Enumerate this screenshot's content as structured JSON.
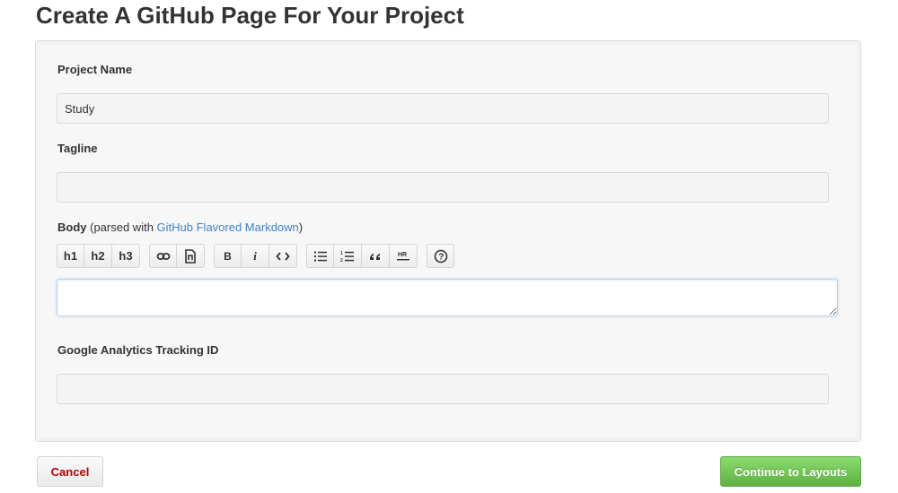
{
  "page": {
    "title": "Create A GitHub Page For Your Project"
  },
  "form": {
    "project_name": {
      "label": "Project Name",
      "value": "Study",
      "placeholder": ""
    },
    "tagline": {
      "label": "Tagline",
      "value": "",
      "placeholder": ""
    },
    "body": {
      "label": "Body",
      "note_prefix": " (parsed with ",
      "link_text": "GitHub Flavored Markdown",
      "note_suffix": ")",
      "value": ""
    },
    "analytics": {
      "label": "Google Analytics Tracking ID",
      "value": "",
      "placeholder": ""
    }
  },
  "toolbar": {
    "h1": "h1",
    "h2": "h2",
    "h3": "h3",
    "bold": "B",
    "italic": "i",
    "icons": [
      "link-icon",
      "image-icon",
      "bold-icon",
      "italic-icon",
      "code-icon",
      "unordered-list-icon",
      "ordered-list-icon",
      "blockquote-icon",
      "horizontal-rule-icon",
      "help-icon"
    ]
  },
  "actions": {
    "cancel": "Cancel",
    "continue": "Continue to Layouts"
  },
  "colors": {
    "accent_link": "#4183c4",
    "cancel_text": "#bb0000",
    "continue_green": "#60b044"
  }
}
